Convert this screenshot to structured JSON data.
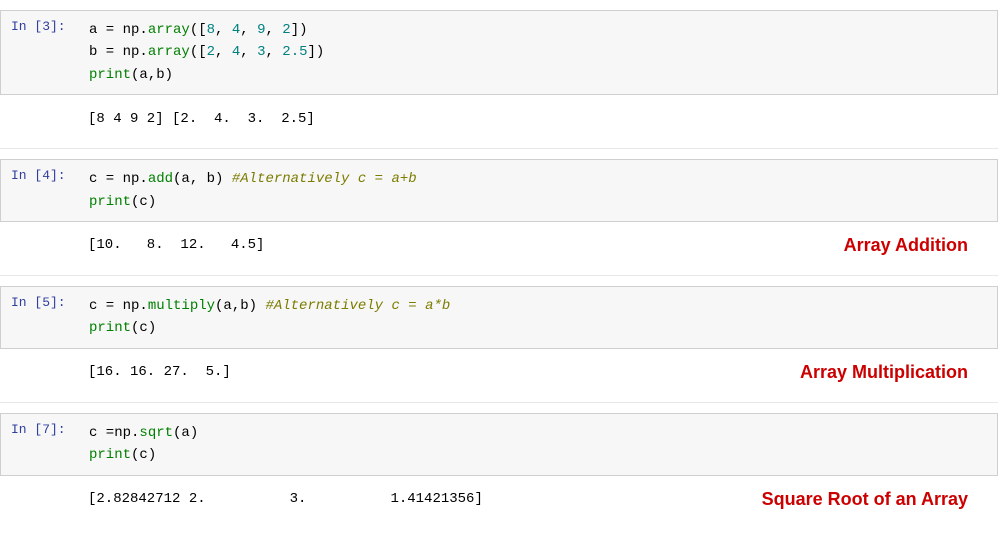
{
  "cells": [
    {
      "id": "cell-3",
      "label": "In [3]:",
      "lines": [
        {
          "parts": [
            {
              "text": "a = np.array([8, 4, 9, 2])",
              "class": "kw-var"
            }
          ]
        },
        {
          "parts": [
            {
              "text": "b = np.array([2, 4, 3, 2.5])",
              "class": "kw-var"
            }
          ]
        },
        {
          "parts": [
            {
              "text": "print(a,b)",
              "class": "kw-print"
            }
          ]
        }
      ],
      "output": "[8 4 9 2] [2.  4.  3.  2.5]",
      "annotation": ""
    },
    {
      "id": "cell-4",
      "label": "In [4]:",
      "lines": [
        {
          "parts": [
            {
              "text": "c = np.add(a, b) ",
              "class": "kw-var"
            },
            {
              "text": "#Alternatively c = a+b",
              "class": "kw-comment"
            }
          ]
        },
        {
          "parts": [
            {
              "text": "print(c)",
              "class": "kw-print"
            }
          ]
        }
      ],
      "output": "[10.   8.  12.   4.5]",
      "annotation": "Array Addition"
    },
    {
      "id": "cell-5",
      "label": "In [5]:",
      "lines": [
        {
          "parts": [
            {
              "text": "c = np.multiply(a,b) ",
              "class": "kw-var"
            },
            {
              "text": "#Alternatively c = a*b",
              "class": "kw-comment"
            }
          ]
        },
        {
          "parts": [
            {
              "text": "print(c)",
              "class": "kw-print"
            }
          ]
        }
      ],
      "output": "[16. 16. 27.  5.]",
      "annotation": "Array Multiplication"
    },
    {
      "id": "cell-7",
      "label": "In [7]:",
      "lines": [
        {
          "parts": [
            {
              "text": "c =np.sqrt(a)",
              "class": "kw-var"
            }
          ]
        },
        {
          "parts": [
            {
              "text": "print(c)",
              "class": "kw-print"
            }
          ]
        }
      ],
      "output": "[2.82842712 2.         3.         1.41421356]",
      "annotation": "Square Root of an Array"
    }
  ],
  "labels": {
    "cell3": "In [3]:",
    "cell4": "In [4]:",
    "cell5": "In [5]:",
    "cell7": "In [7]:"
  }
}
